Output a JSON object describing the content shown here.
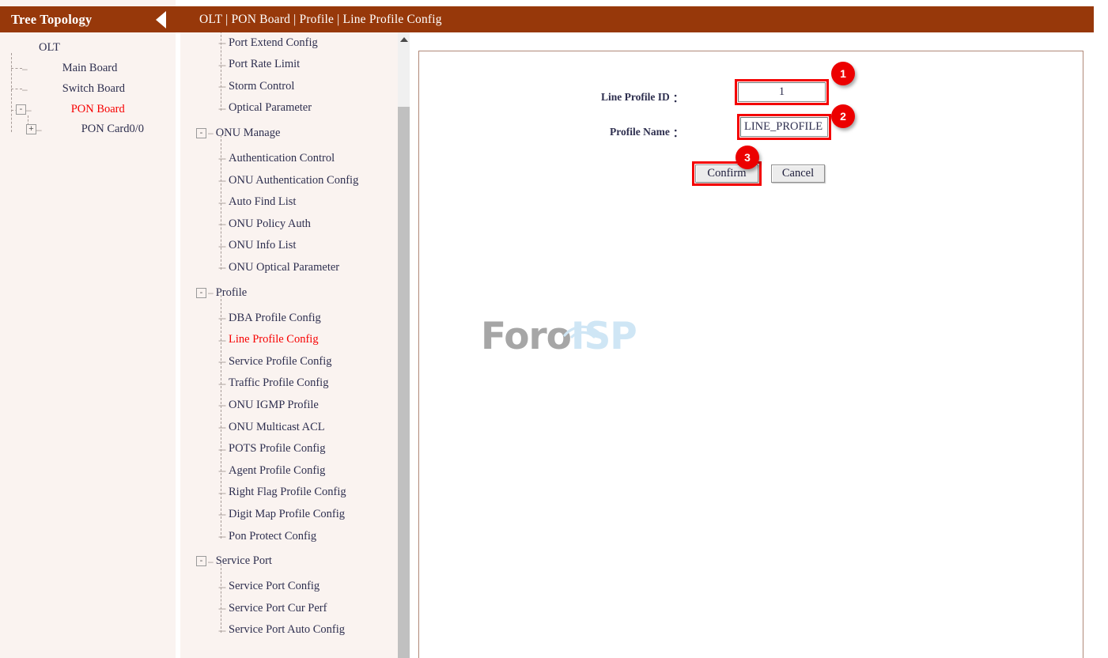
{
  "sidebar": {
    "title": "Tree Topology",
    "collapse_icon": "triangle-left-icon",
    "tree": [
      {
        "label": "OLT",
        "icon": "device-olt-icon",
        "expander": null,
        "active": false
      },
      {
        "label": "Main Board",
        "icon": "device-board-icon",
        "expander": null,
        "active": false
      },
      {
        "label": "Switch Board",
        "icon": "device-board-icon",
        "expander": null,
        "active": false
      },
      {
        "label": "PON Board",
        "icon": "device-board-icon",
        "expander": "-",
        "active": true
      },
      {
        "label": "PON Card0/0",
        "icon": "device-card-icon",
        "expander": "+",
        "active": false
      }
    ]
  },
  "topbar": {
    "breadcrumb": "OLT | PON Board | Profile | Line Profile Config"
  },
  "menu": {
    "items": [
      {
        "label": "Port Extend Config",
        "type": "leaf",
        "active": false
      },
      {
        "label": "Port Rate Limit",
        "type": "leaf",
        "active": false
      },
      {
        "label": "Storm Control",
        "type": "leaf",
        "active": false
      },
      {
        "label": "Optical Parameter",
        "type": "leaf",
        "active": false,
        "last": true
      },
      {
        "label": "ONU Manage",
        "type": "group",
        "active": false,
        "expander": "-"
      },
      {
        "label": "Authentication Control",
        "type": "leaf",
        "active": false
      },
      {
        "label": "ONU Authentication Config",
        "type": "leaf",
        "active": false
      },
      {
        "label": "Auto Find List",
        "type": "leaf",
        "active": false
      },
      {
        "label": "ONU Policy Auth",
        "type": "leaf",
        "active": false
      },
      {
        "label": "ONU Info List",
        "type": "leaf",
        "active": false
      },
      {
        "label": "ONU Optical Parameter",
        "type": "leaf",
        "active": false,
        "last": true
      },
      {
        "label": "Profile",
        "type": "group",
        "active": false,
        "expander": "-"
      },
      {
        "label": "DBA Profile Config",
        "type": "leaf",
        "active": false
      },
      {
        "label": "Line Profile Config",
        "type": "leaf",
        "active": true
      },
      {
        "label": "Service Profile Config",
        "type": "leaf",
        "active": false
      },
      {
        "label": "Traffic Profile Config",
        "type": "leaf",
        "active": false
      },
      {
        "label": "ONU IGMP Profile",
        "type": "leaf",
        "active": false
      },
      {
        "label": "ONU Multicast ACL",
        "type": "leaf",
        "active": false
      },
      {
        "label": "POTS Profile Config",
        "type": "leaf",
        "active": false
      },
      {
        "label": "Agent Profile Config",
        "type": "leaf",
        "active": false
      },
      {
        "label": "Right Flag Profile Config",
        "type": "leaf",
        "active": false
      },
      {
        "label": "Digit Map Profile Config",
        "type": "leaf",
        "active": false
      },
      {
        "label": "Pon Protect Config",
        "type": "leaf",
        "active": false,
        "last": true
      },
      {
        "label": "Service Port",
        "type": "group",
        "active": false,
        "expander": "-"
      },
      {
        "label": "Service Port Config",
        "type": "leaf",
        "active": false
      },
      {
        "label": "Service Port Cur Perf",
        "type": "leaf",
        "active": false
      },
      {
        "label": "Service Port Auto Config",
        "type": "leaf",
        "active": false,
        "last": true
      }
    ],
    "scroll_up_icon": "triangle-up-icon"
  },
  "form": {
    "fields": [
      {
        "label": "Line Profile ID",
        "colon": "：",
        "value": "1",
        "align": "center"
      },
      {
        "label": "Profile Name",
        "colon": "：",
        "value": "LINE_PROFILE",
        "align": "left"
      }
    ],
    "buttons": [
      {
        "label": "Confirm"
      },
      {
        "label": "Cancel"
      }
    ]
  },
  "annotations": {
    "badges": [
      {
        "number": "1"
      },
      {
        "number": "2"
      },
      {
        "number": "3"
      }
    ],
    "color": "#ec0000"
  },
  "watermark": {
    "text_primary": "Foro",
    "text_secondary": "ISP",
    "icon": "wifi-signal-icon",
    "color_primary": "#a6a6a6",
    "color_secondary": "#cfe6f5"
  },
  "theme": {
    "header_bg": "#97380a",
    "panel_bg": "#faf3f0",
    "border": "#b08878",
    "active_text": "#f70000"
  }
}
